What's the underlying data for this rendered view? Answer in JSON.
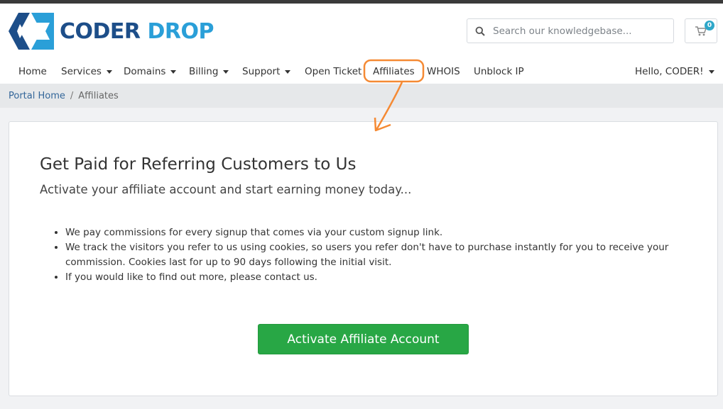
{
  "brand": {
    "word1": "CODER",
    "word2": "DROP"
  },
  "search": {
    "placeholder": "Search our knowledgebase..."
  },
  "cart": {
    "count": "0"
  },
  "nav": {
    "home": "Home",
    "services": "Services",
    "domains": "Domains",
    "billing": "Billing",
    "support": "Support",
    "open_ticket": "Open Ticket",
    "affiliates": "Affiliates",
    "whois": "WHOIS",
    "unblock_ip": "Unblock IP",
    "user": "Hello, CODER!"
  },
  "breadcrumb": {
    "home": "Portal Home",
    "separator": "/",
    "current": "Affiliates"
  },
  "main": {
    "title": "Get Paid for Referring Customers to Us",
    "subtitle": "Activate your affiliate account and start earning money today...",
    "bullets": [
      "We pay commissions for every signup that comes via your custom signup link.",
      "We track the visitors you refer to us using cookies, so users you refer don't have to purchase instantly for you to receive your commission. Cookies last for up to 90 days following the initial visit.",
      "If you would like to find out more, please contact us."
    ],
    "activate_button": "Activate Affiliate Account"
  },
  "colors": {
    "brand_dark": "#1d4e89",
    "brand_light": "#2a9fd8",
    "button_green": "#28a745",
    "annotation_orange": "#f58a34"
  },
  "icons": {
    "search": "search-icon",
    "cart": "cart-icon"
  }
}
